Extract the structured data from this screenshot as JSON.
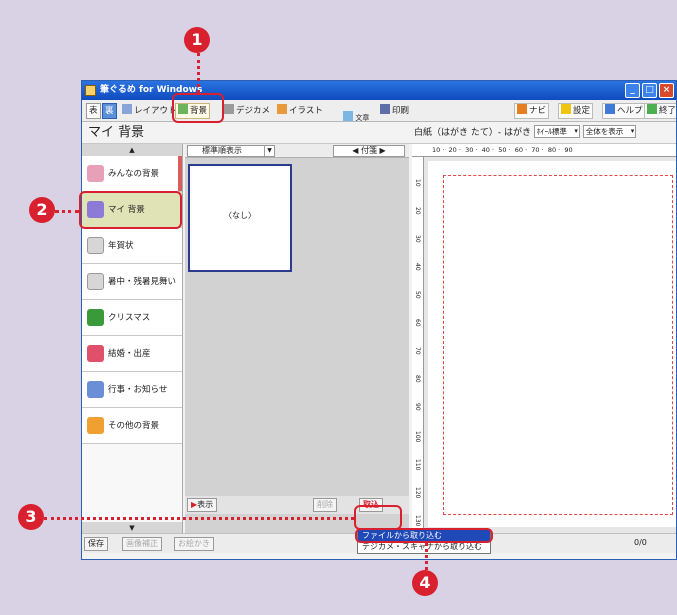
{
  "window": {
    "title": "筆ぐるめ for Windows",
    "controls": [
      "_",
      "□",
      "×"
    ]
  },
  "toolbar": {
    "items": [
      "表",
      "裏",
      "レイアウト",
      "背景",
      "デジカメ",
      "イラスト",
      "文章\n差し込み",
      "印刷"
    ],
    "right_items": [
      "ナビ",
      "設定",
      "ヘルプ",
      "終了"
    ]
  },
  "left_panel": {
    "title": "マイ 背景",
    "up_arrow": "▲",
    "down_arrow": "▼",
    "categories": [
      "みんなの背景",
      "マイ 背景",
      "年賀状",
      "暑中・残暑見舞い",
      "クリスマス",
      "結婚・出産",
      "行事・お知らせ",
      "その他の背景"
    ],
    "selected_index": 1
  },
  "middle_panel": {
    "sort_label": "標準順表示",
    "filter_label": "付箋",
    "thumb_label": "〈なし〉",
    "bottom_left_button": "表示",
    "bottom_mid_button": "削除",
    "import_button": "取込"
  },
  "import_menu": {
    "items": [
      "ファイルから取り込む",
      "デジカメ・スキャナから取り込む"
    ]
  },
  "statusbar": {
    "save": "保存",
    "image_fix": "画像補正",
    "ekaki": "お絵かき",
    "page": "0/0"
  },
  "preview": {
    "title": "白紙（はがき たて）- はがき",
    "font_select": "ﾎｲｰﾙ標準",
    "view_select": "全体を表示",
    "ruler_top": [
      "10",
      "20",
      "30",
      "40",
      "50",
      "60",
      "70",
      "80",
      "90"
    ],
    "ruler_left": [
      "10",
      "20",
      "30",
      "40",
      "50",
      "60",
      "70",
      "80",
      "90",
      "100",
      "110",
      "120",
      "130"
    ]
  },
  "callouts": [
    "1",
    "2",
    "3",
    "4"
  ],
  "colors": {
    "accent_red": "#d8202e",
    "title_blue": "#1f5fd6",
    "selection_olive": "#dfe3b6",
    "menu_highlight": "#2049b8"
  }
}
